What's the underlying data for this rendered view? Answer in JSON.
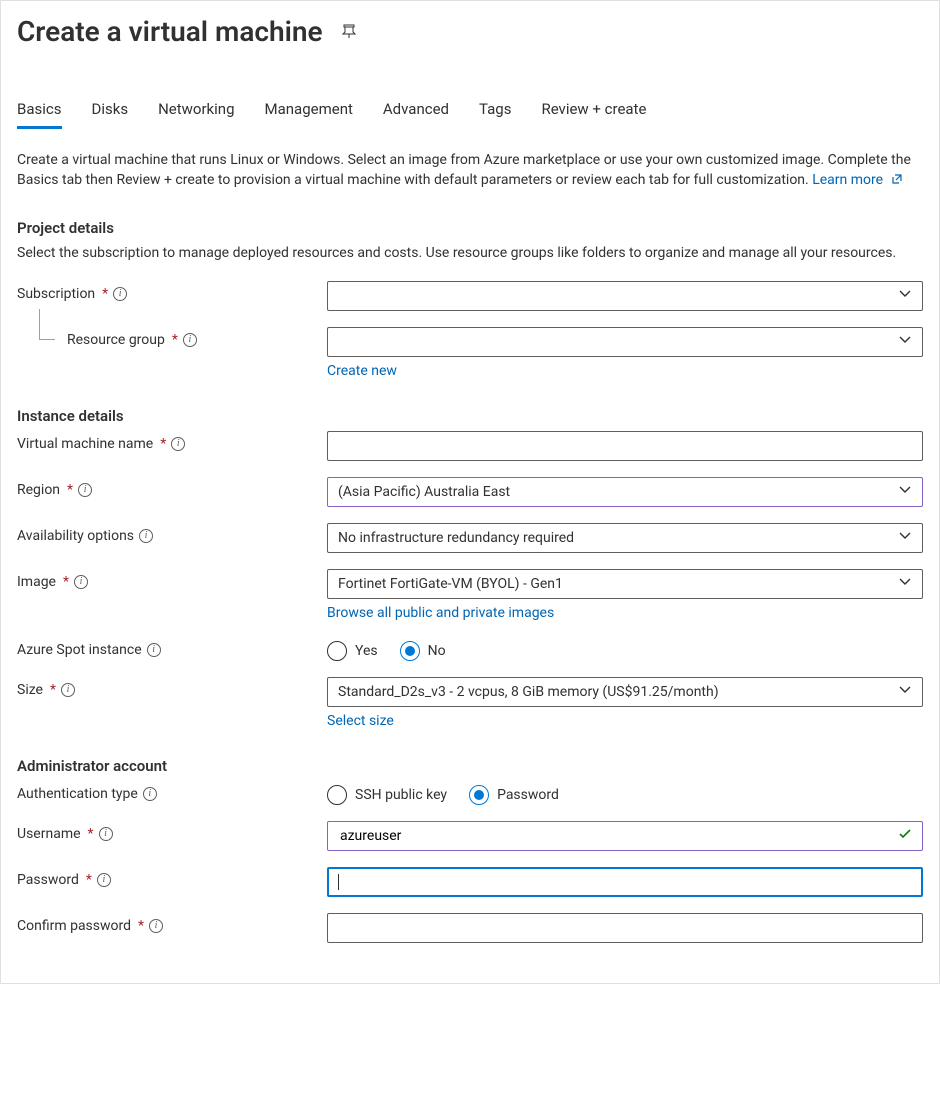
{
  "header": {
    "title": "Create a virtual machine"
  },
  "tabs": [
    "Basics",
    "Disks",
    "Networking",
    "Management",
    "Advanced",
    "Tags",
    "Review + create"
  ],
  "intro": {
    "text": "Create a virtual machine that runs Linux or Windows. Select an image from Azure marketplace or use your own customized image. Complete the Basics tab then Review + create to provision a virtual machine with default parameters or review each tab for full customization. ",
    "learn_more": "Learn more"
  },
  "sections": {
    "project": {
      "title": "Project details",
      "desc": "Select the subscription to manage deployed resources and costs. Use resource groups like folders to organize and manage all your resources.",
      "subscription_label": "Subscription",
      "resource_group_label": "Resource group",
      "create_new": "Create new"
    },
    "instance": {
      "title": "Instance details",
      "vm_name_label": "Virtual machine name",
      "region_label": "Region",
      "region_value": "(Asia Pacific) Australia East",
      "availability_label": "Availability options",
      "availability_value": "No infrastructure redundancy required",
      "image_label": "Image",
      "image_value": "Fortinet FortiGate-VM (BYOL) - Gen1",
      "browse_images": "Browse all public and private images",
      "spot_label": "Azure Spot instance",
      "spot_yes": "Yes",
      "spot_no": "No",
      "size_label": "Size",
      "size_value": "Standard_D2s_v3 - 2 vcpus, 8 GiB memory (US$91.25/month)",
      "select_size": "Select size"
    },
    "admin": {
      "title": "Administrator account",
      "auth_type_label": "Authentication type",
      "auth_ssh": "SSH public key",
      "auth_password": "Password",
      "username_label": "Username",
      "username_value": "azureuser",
      "password_label": "Password",
      "confirm_label": "Confirm password"
    }
  }
}
